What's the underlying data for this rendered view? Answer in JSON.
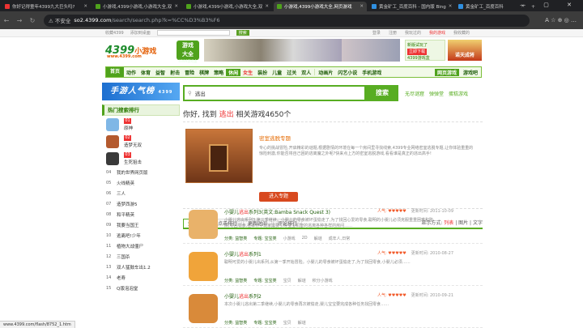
{
  "browser": {
    "tabs": [
      {
        "title": "你好记得童年4399九大巨头吗?",
        "active": false,
        "color": "#e33"
      },
      {
        "title": "小游戏,4399小游戏,小游戏大全,双",
        "active": false,
        "color": "#4fa21c"
      },
      {
        "title": "小游戏,4399小游戏,小游戏大全,双",
        "active": false,
        "color": "#4fa21c"
      },
      {
        "title": "小游戏,4399小游戏大全,网页游戏",
        "active": true,
        "color": "#4fa21c"
      },
      {
        "title": "黄金矿工_百度百科 - 国内版 Bing",
        "active": false,
        "color": "#2f8fe0"
      },
      {
        "title": "黄金矿工_百度百科",
        "active": false,
        "color": "#2f8fe0"
      }
    ],
    "new_tab": "+",
    "window_controls": "— ▢ ✕",
    "back": "←",
    "forward": "→",
    "reload": "↻",
    "security": "⚠ 不安全",
    "url_domain": "so2.4399.com",
    "url_path": "/search/search.php?k=%CC%D3%B3%F6",
    "right_icons": "A ☆ ⊕ ◎ …"
  },
  "topbar": {
    "left1": "收藏4399",
    "left2": "添加到桌面",
    "search_btn": "搜索",
    "user": "登录",
    "reg": "注册",
    "history": "我玩过的",
    "fav": "我的游戏",
    "fav_red": "我收藏的"
  },
  "logo": {
    "num": "4399",
    "text": "小游戏",
    "url": "www.4399.com"
  },
  "logo2": {
    "line1": "游戏",
    "line2": "大全",
    "sub": "4399游戏盒"
  },
  "promo": {
    "line1": "新版试玩了",
    "btn": "立即下载",
    "line2": "4399游戏盒"
  },
  "promo2_text": "诺天成将",
  "nav": {
    "items": [
      "首页",
      "动作",
      "体育",
      "益智",
      "射击",
      "冒险",
      "棋牌",
      "策略",
      "休闲",
      "女生",
      "装扮",
      "儿童",
      "过关",
      "双人",
      "动画片",
      "闪艺小说",
      "手机游戏"
    ],
    "right_box": "网页游戏",
    "right_text": "游戏吧"
  },
  "mobile_banner": {
    "title": "手游人气榜",
    "sub": "4399"
  },
  "rank": {
    "heading": "热门搜索排行",
    "top": [
      {
        "num": "01",
        "name": "原神",
        "color": "#7fb7e6"
      },
      {
        "num": "02",
        "name": "造梦无双",
        "color": "#b45a2e"
      },
      {
        "num": "03",
        "name": "生死狙击",
        "color": "#3a3a3a"
      }
    ],
    "items": [
      {
        "num": "04",
        "name": "我的世界网页版"
      },
      {
        "num": "05",
        "name": "火线精英"
      },
      {
        "num": "06",
        "name": "三人"
      },
      {
        "num": "07",
        "name": "造梦西游5"
      },
      {
        "num": "08",
        "name": "和平精英"
      },
      {
        "num": "09",
        "name": "我要当国王"
      },
      {
        "num": "10",
        "name": "逃离吧!少年"
      },
      {
        "num": "11",
        "name": "植物大战僵尸"
      },
      {
        "num": "12",
        "name": "三国杀"
      },
      {
        "num": "13",
        "name": "双人猛鼓车出1.2"
      },
      {
        "num": "14",
        "name": "老寿"
      },
      {
        "num": "15",
        "name": "Q版泡泡堂"
      }
    ]
  },
  "search": {
    "query": "逃出",
    "button": "搜索",
    "hot": [
      "无尽谜窟",
      "弹弹堂",
      "蛋糕游戏"
    ]
  },
  "result_count": {
    "prefix": "你好, 找到 ",
    "keyword": "逃出",
    "suffix": " 相关游戏4650个"
  },
  "special": {
    "title": "密室逃脱专题",
    "desc": "专心的挑战冒险,开启精彩的谜题,根据剧情的环境在每一个房间里寻找线索,4399专业网络密室逃脱专题,让你体验重重的惊险刺激,你能否将自己困的逃离魔之外呢?快来点上方的密室逃脱游戏,看看谁是真正的逃出高手!",
    "button": "进入专题"
  },
  "tabs": {
    "items": [
      "推荐结果",
      "点击排行",
      "更新时间",
      "评论排行"
    ],
    "view_label": "显示方式:",
    "view_list": "列表",
    "view_pic": "图片",
    "view_text": "文字"
  },
  "results": [
    {
      "title_pre": "小婴儿",
      "kw": "逃出",
      "title_post": "系列3(英文:Bamba Snack Quest 3)",
      "desc": "小婴儿逃出系列3,第三季继续。小婴儿的零食被坏蛋偷走了,为了找回心爱的零食,聪明的小婴儿必须克服重重困难和陷阱,寻回零食,在本作中玩家需要引导宝宝机智的逃离各种各样的房间……",
      "tags": [
        "分类: 益智类",
        "专题: 宝宝类",
        "小游戏",
        "2D",
        "解谜",
        "成年人,日常"
      ],
      "popularity": "人气: ♥♥♥♥♥",
      "date": "更新时间: 2011-10-09",
      "thumb_color": "#e9b26a"
    },
    {
      "title_pre": "小婴儿",
      "kw": "逃出",
      "title_post": "系列1",
      "desc": "聪明可爱的小婴儿出系列,从第一季开始冒险。小婴儿的零食被坏蛋偷走了,为了找回零食,小婴儿必须……",
      "tags": [
        "分类: 益智类",
        "专题: 宝宝类",
        "宝贝",
        "解谜",
        "积分小游戏"
      ],
      "popularity": "人气: ♥♥♥♥♥",
      "date": "更新时间: 2010-08-27",
      "thumb_color": "#f0a43a"
    },
    {
      "title_pre": "小婴儿",
      "kw": "逃出",
      "title_post": "系列2",
      "desc": "本次小婴儿逃出第二季继续,小婴儿的零食再次被偷走,婴儿宝宝要完成各种任务找回零食……",
      "tags": [
        "分类: 益智类",
        "专题: 宝宝类",
        "宝贝",
        "解谜"
      ],
      "popularity": "人气: ♥♥♥♥♥",
      "date": "更新时间: 2010-09-21",
      "thumb_color": "#d98a3a"
    }
  ],
  "status_url": "www.4399.com/flash/8752_1.htm"
}
